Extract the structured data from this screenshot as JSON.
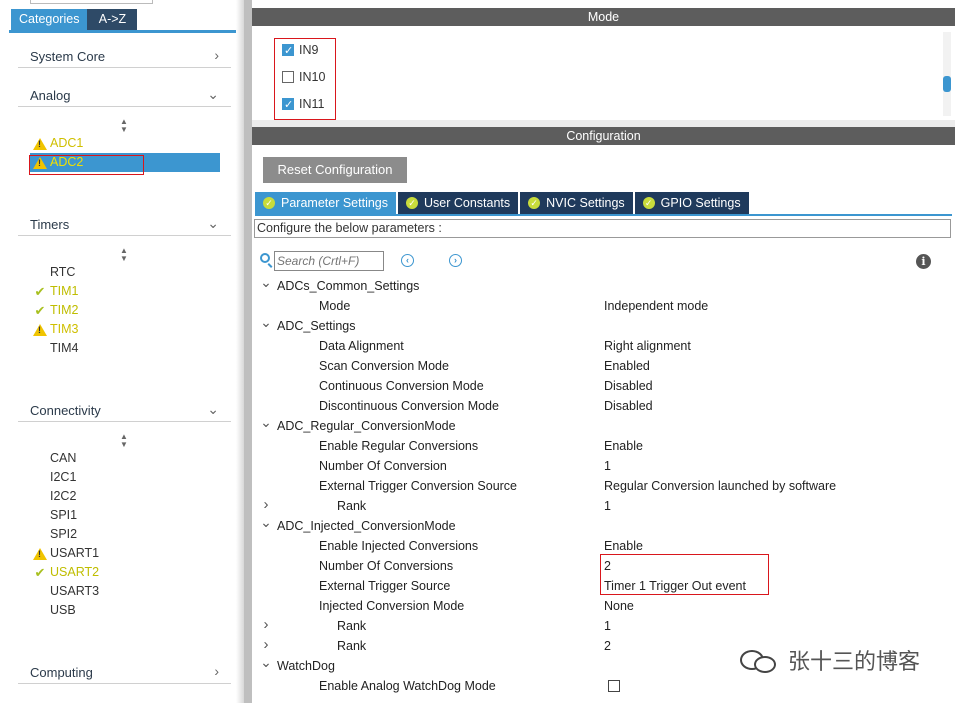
{
  "sidebar": {
    "tabs": [
      {
        "label": "Categories",
        "active": true
      },
      {
        "label": "A->Z",
        "active": false
      }
    ],
    "categories": [
      {
        "label": "System Core",
        "expanded": false
      },
      {
        "label": "Analog",
        "expanded": true
      },
      {
        "label": "Timers",
        "expanded": true
      },
      {
        "label": "Connectivity",
        "expanded": true
      },
      {
        "label": "Computing",
        "expanded": false
      }
    ],
    "analog_items": [
      {
        "label": "ADC1",
        "status": "warning"
      },
      {
        "label": "ADC2",
        "status": "warning",
        "selected": true
      }
    ],
    "timer_items": [
      {
        "label": "RTC",
        "status": "none"
      },
      {
        "label": "TIM1",
        "status": "ok"
      },
      {
        "label": "TIM2",
        "status": "ok"
      },
      {
        "label": "TIM3",
        "status": "warning"
      },
      {
        "label": "TIM4",
        "status": "none"
      }
    ],
    "connectivity_items": [
      {
        "label": "CAN",
        "status": "none"
      },
      {
        "label": "I2C1",
        "status": "none"
      },
      {
        "label": "I2C2",
        "status": "none"
      },
      {
        "label": "SPI1",
        "status": "none"
      },
      {
        "label": "SPI2",
        "status": "none"
      },
      {
        "label": "USART1",
        "status": "warning"
      },
      {
        "label": "USART2",
        "status": "ok"
      },
      {
        "label": "USART3",
        "status": "none"
      },
      {
        "label": "USB",
        "status": "none"
      }
    ]
  },
  "mode": {
    "header": "Mode",
    "channels": [
      {
        "label": "IN9",
        "checked": true
      },
      {
        "label": "IN10",
        "checked": false
      },
      {
        "label": "IN11",
        "checked": true
      }
    ]
  },
  "configuration": {
    "header": "Configuration",
    "reset_label": "Reset Configuration",
    "tabs": [
      {
        "label": "Parameter Settings",
        "active": true
      },
      {
        "label": "User Constants",
        "active": false
      },
      {
        "label": "NVIC Settings",
        "active": false
      },
      {
        "label": "GPIO Settings",
        "active": false
      }
    ],
    "configure_text": "Configure the below parameters :",
    "search_placeholder": "Search (Crtl+F)",
    "rows": [
      {
        "kind": "group",
        "toggle": "v",
        "name": "ADCs_Common_Settings",
        "value": ""
      },
      {
        "kind": "param",
        "name": "Mode",
        "value": "Independent mode"
      },
      {
        "kind": "group",
        "toggle": "v",
        "name": "ADC_Settings",
        "value": ""
      },
      {
        "kind": "param",
        "name": "Data Alignment",
        "value": "Right alignment"
      },
      {
        "kind": "param",
        "name": "Scan Conversion Mode",
        "value": "Enabled"
      },
      {
        "kind": "param",
        "name": "Continuous Conversion Mode",
        "value": "Disabled"
      },
      {
        "kind": "param",
        "name": "Discontinuous Conversion Mode",
        "value": "Disabled"
      },
      {
        "kind": "group",
        "toggle": "v",
        "name": "ADC_Regular_ConversionMode",
        "value": ""
      },
      {
        "kind": "param",
        "name": "Enable Regular Conversions",
        "value": "Enable"
      },
      {
        "kind": "param",
        "name": "Number Of Conversion",
        "value": "1"
      },
      {
        "kind": "param",
        "name": "External Trigger Conversion Source",
        "value": "Regular Conversion launched by software"
      },
      {
        "kind": "sub",
        "toggle": ">",
        "name": "Rank",
        "value": "1"
      },
      {
        "kind": "group",
        "toggle": "v",
        "name": "ADC_Injected_ConversionMode",
        "value": ""
      },
      {
        "kind": "param",
        "name": "Enable Injected Conversions",
        "value": "Enable"
      },
      {
        "kind": "param",
        "name": "Number Of Conversions",
        "value": "2"
      },
      {
        "kind": "param",
        "name": "External Trigger Source",
        "value": "Timer 1 Trigger Out event"
      },
      {
        "kind": "param",
        "name": "Injected Conversion Mode",
        "value": "None"
      },
      {
        "kind": "sub",
        "toggle": ">",
        "name": "Rank",
        "value": "1"
      },
      {
        "kind": "sub",
        "toggle": ">",
        "name": "Rank",
        "value": "2"
      },
      {
        "kind": "group",
        "toggle": "v",
        "name": "WatchDog",
        "value": ""
      },
      {
        "kind": "checkbox",
        "name": "Enable Analog WatchDog Mode",
        "value": "",
        "checked": false
      }
    ]
  },
  "watermark": "张十三的博客",
  "colors": {
    "accent": "#3c96d0",
    "dark_tab": "#1f3a5c",
    "warning": "#f0c400",
    "ok": "#a8c020",
    "highlight_box": "#d9161c"
  }
}
